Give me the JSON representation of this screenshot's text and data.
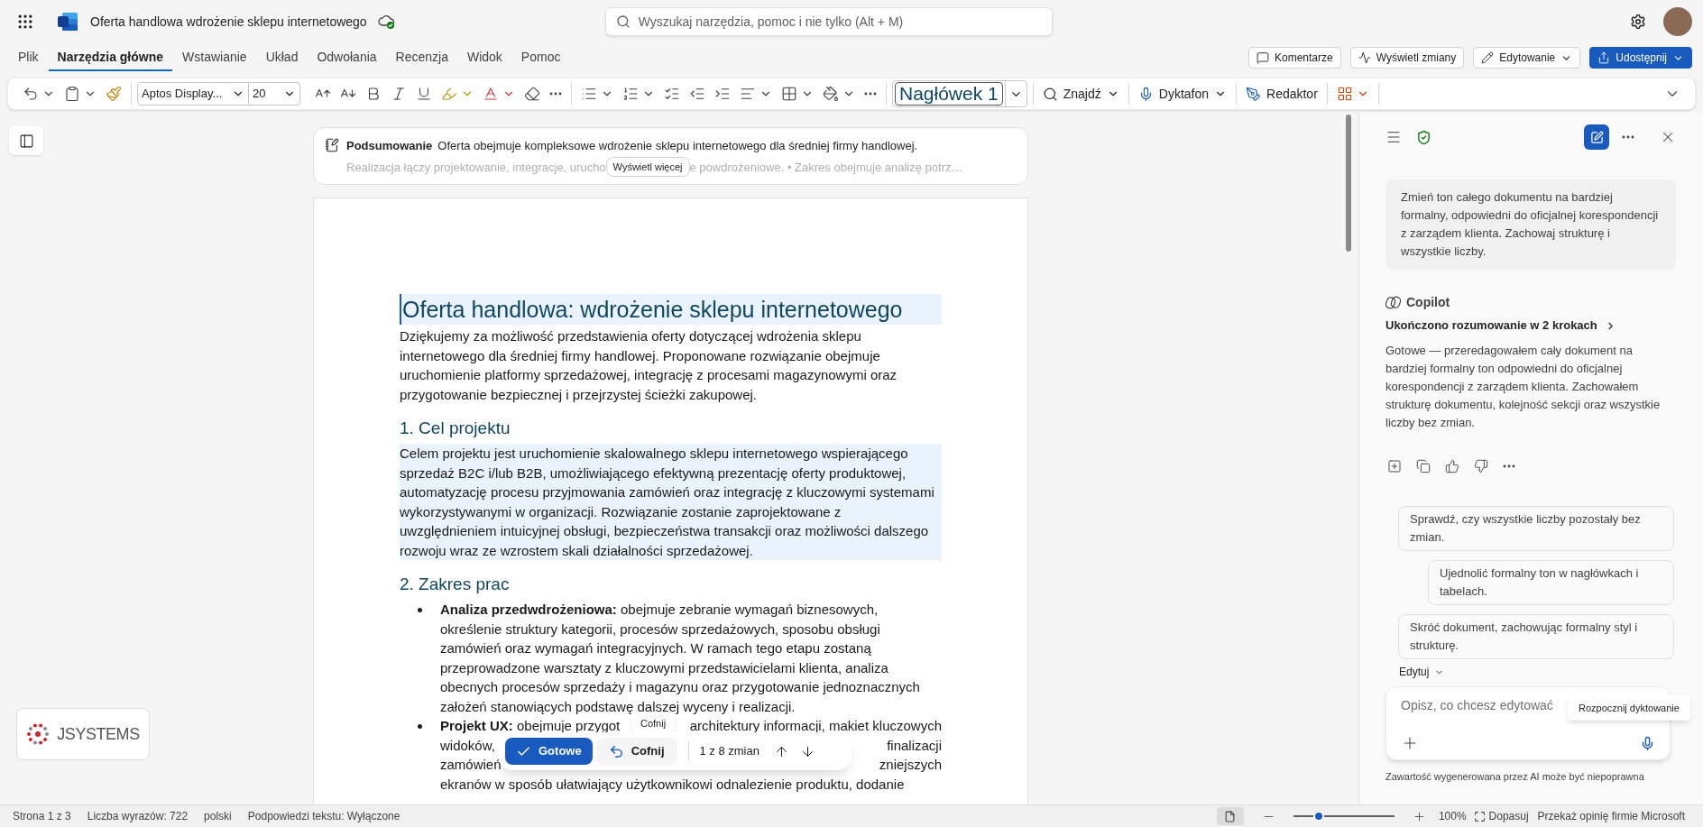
{
  "app": {
    "document_title": "Oferta handlowa wdrożenie sklepu internetowego",
    "search": {
      "placeholder": "Wyszukaj narzędzia, pomoc i nie tylko (Alt + M)"
    }
  },
  "tabs": [
    {
      "label": "Plik",
      "selected": false
    },
    {
      "label": "Narzędzia główne",
      "selected": true
    },
    {
      "label": "Wstawianie",
      "selected": false
    },
    {
      "label": "Układ",
      "selected": false
    },
    {
      "label": "Odwołania",
      "selected": false
    },
    {
      "label": "Recenzja",
      "selected": false
    },
    {
      "label": "Widok",
      "selected": false
    },
    {
      "label": "Pomoc",
      "selected": false
    }
  ],
  "header_buttons": [
    {
      "label": "Komentarze",
      "kind": "comments"
    },
    {
      "label": "Wyświetl zmiany",
      "kind": "changes"
    },
    {
      "label": "Edytowanie",
      "kind": "editing"
    },
    {
      "label": "Udostępnij",
      "kind": "share"
    }
  ],
  "ribbon": {
    "font": "Aptos Display...",
    "font_size": "20",
    "style": "Nagłówek 1",
    "commands": [
      {
        "label": "Znajdź",
        "kind": "find"
      },
      {
        "label": "Dyktafon",
        "kind": "dictate"
      },
      {
        "label": "Redaktor",
        "kind": "editor"
      }
    ]
  },
  "summary": {
    "label": "Podsumowanie",
    "text": "Oferta obejmuje kompleksowe wdrożenie sklepu internetowego dla średniej firmy handlowej.",
    "preview_start": "Realizacja łączy projektowanie, integracje, urucho",
    "preview_end": "e powdrożeniowe. • Zakres obejmuje analizę potrz…",
    "button": "Wyświetl więcej"
  },
  "document": {
    "title": {
      "text": "Oferta handlowa: wdrożenie sklepu internetowego",
      "highlighted": true
    },
    "blocks": [
      {
        "kind": "paragraph",
        "text": "Dziękujemy za możliwość przedstawienia oferty dotyczącej wdrożenia sklepu internetowego dla średniej firmy handlowej. Proponowane rozwiązanie obejmuje uruchomienie platformy sprzedażowej, integrację z procesami magazynowymi oraz przygotowanie bezpiecznej i przejrzystej ścieżki zakupowej.",
        "highlighted": false
      },
      {
        "kind": "heading",
        "text": "1. Cel projektu"
      },
      {
        "kind": "paragraph",
        "text": "Celem projektu jest uruchomienie skalowalnego sklepu internetowego wspierającego sprzedaż B2C i/lub B2B, umożliwiającego efektywną prezentację oferty produktowej, automatyzację procesu przyjmowania zamówień oraz integrację z kluczowymi systemami wykorzystywanymi w organizacji. Rozwiązanie zostanie zaprojektowane z uwzględnieniem intuicyjnej obsługi, bezpieczeństwa transakcji oraz możliwości dalszego rozwoju wraz ze wzrostem skali działalności sprzedażowej.",
        "highlighted": true
      },
      {
        "kind": "heading",
        "text": "2. Zakres prac"
      },
      {
        "kind": "bullet",
        "text": "**Analiza przedwdrożeniowa:** obejmuje zebranie wymagań biznesowych, określenie struktury kategorii, procesów sprzedażowych, sposobu obsługi zamówień oraz wymagań integracyjnych. W ramach tego etapu zostaną przeprowadzone warsztaty z kluczowymi przedstawicielami klienta, analiza obecnych procesów sprzedaży i magazynu oraz przygotowanie jednoznacznych założeń stanowiących podstawę dalszej wyceny i realizacji."
      },
      {
        "kind": "bullet_lines",
        "lines": [
          [
            "**Projekt UX:** obejmuje przygot",
            "architektury informacji, makiet kluczowych"
          ],
          [
            "widoków,",
            "finalizacji"
          ],
          [
            "zamówień",
            "zniejszych"
          ],
          [
            "ekranów w sposób ułatwiający użytkownikowi odnalezienie produktu, dodanie"
          ]
        ]
      }
    ]
  },
  "change_bar": {
    "accept": "Gotowe",
    "undo": "Cofnij",
    "counter": "1 z 8 zmian",
    "tooltip": "Cofnij"
  },
  "logo": {
    "text": "JSYSTEMS"
  },
  "copilot": {
    "user_message": "Zmień ton całego dokumentu na bardziej formalny, odpowiedni do oficjalnej korespondencji z zarządem klienta. Zachowaj strukturę i wszystkie liczby.",
    "name": "Copilot",
    "reasoning": "Ukończono rozumowanie w 2 krokach",
    "response": "Gotowe — przeredagowałem cały dokument na bardziej formalny ton odpowiedni do oficjalnej korespondencji z zarządem klienta. Zachowałem strukturę dokumentu, kolejność sekcji oraz wszystkie liczby bez zmian.",
    "suggestions": [
      "Sprawdź, czy wszystkie liczby pozostały bez zmian.",
      "Ujednolić formalny ton w nagłówkach i tabelach.",
      "Skróć dokument, zachowując formalny styl i strukturę."
    ],
    "mode": "Edytuj",
    "input": {
      "placeholder": "Opisz, co chcesz edytować"
    },
    "tooltip": "Rozpocznij dyktowanie",
    "disclaimer": "Zawartość wygenerowana przez AI może być niepoprawna"
  },
  "status_bar": {
    "items": [
      "Strona 1 z 3",
      "Liczba wyrazów: 722",
      "polski",
      "Podpowiedzi tekstu: Wyłączone"
    ],
    "zoom": {
      "level": 0.25,
      "reading": "100%"
    },
    "fit": "Dopasuj",
    "feedback": "Przekaż opinię firmie Microsoft"
  }
}
